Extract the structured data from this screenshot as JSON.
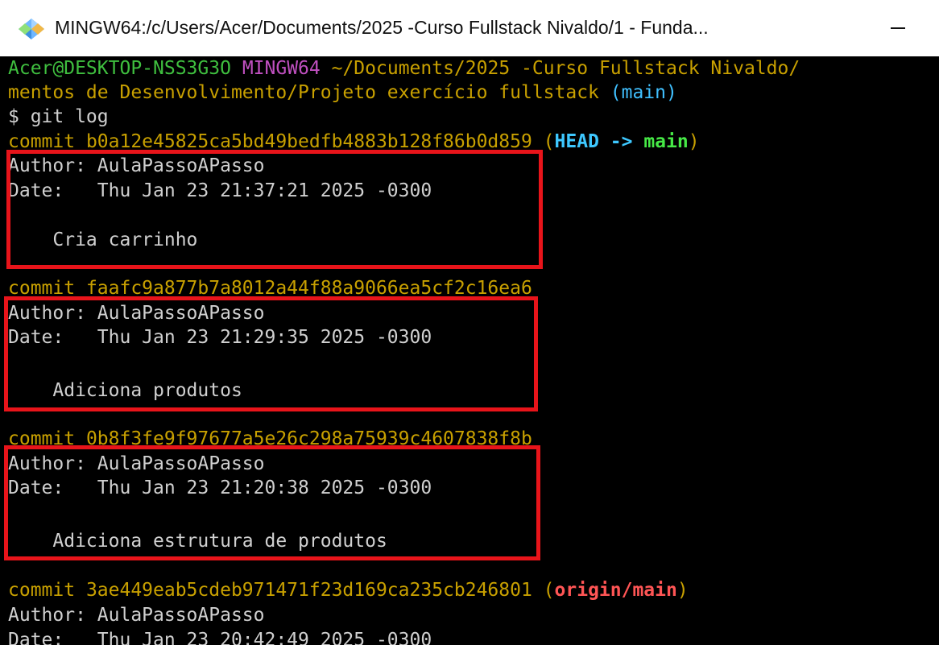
{
  "window": {
    "title": "MINGW64:/c/Users/Acer/Documents/2025 -Curso Fullstack Nivaldo/1 - Funda...",
    "icon": "git-diamond-icon",
    "minimize_icon": "minimize-icon"
  },
  "prompt": {
    "user_host": "Acer@DESKTOP-NSS3G3O",
    "env": "MINGW64",
    "path_line1": "~/Documents/2025 -Curso Fullstack Nivaldo/",
    "path_line2": "mentos de Desenvolvimento/Projeto exercício fullstack",
    "branch": "(main)",
    "command": "$ git log"
  },
  "commits": [
    {
      "prefix": "commit ",
      "hash": "b0a12e45825ca5bd49bedfb4883b128f86b0d859",
      "ref_open": " (",
      "ref_head": "HEAD -> ",
      "ref_branch": "main",
      "ref_close": ")",
      "author": "Author: AulaPassoAPasso",
      "date": "Date:   Thu Jan 23 21:37:21 2025 -0300",
      "message": "    Cria carrinho"
    },
    {
      "prefix": "commit ",
      "hash": "faafc9a877b7a8012a44f88a9066ea5cf2c16ea6",
      "author": "Author: AulaPassoAPasso",
      "date": "Date:   Thu Jan 23 21:29:35 2025 -0300",
      "message": "    Adiciona produtos"
    },
    {
      "prefix": "commit ",
      "hash": "0b8f3fe9f97677a5e26c298a75939c4607838f8b",
      "author": "Author: AulaPassoAPasso",
      "date": "Date:   Thu Jan 23 21:20:38 2025 -0300",
      "message": "    Adiciona estrutura de produtos"
    },
    {
      "prefix": "commit ",
      "hash": "3ae449eab5cdeb971471f23d169ca235cb246801",
      "ref_open": " (",
      "ref_branch": "origin/main",
      "ref_close": ")",
      "author": "Author: AulaPassoAPasso",
      "date": "Date:   Thu Jan 23 20:42:49 2025 -0300"
    }
  ],
  "colors": {
    "prompt_user": "#3fbf3f",
    "prompt_env": "#c050c0",
    "prompt_path": "#c8a000",
    "branch": "#40c0ff",
    "commit": "#c8a000",
    "head_ref": "#3ec8ff",
    "main_ref": "#46e846",
    "origin_ref": "#ff5555",
    "highlight_box": "#e8141a",
    "text": "#d0d0d0"
  }
}
